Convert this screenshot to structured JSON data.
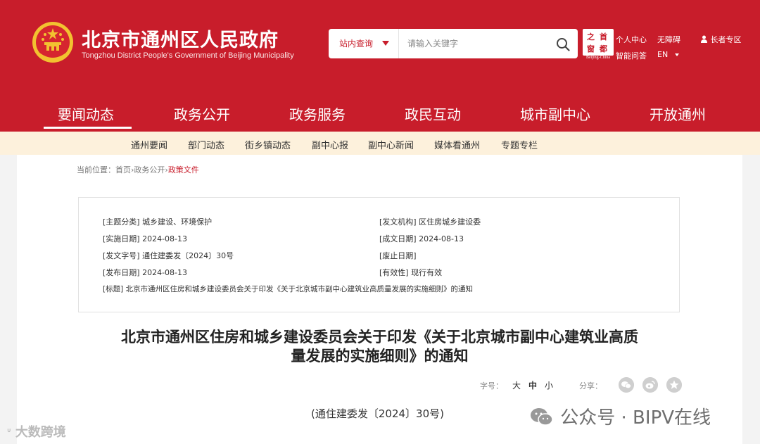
{
  "header": {
    "site_title": "北京市通州区人民政府",
    "site_subtitle": "Tongzhou District People's Government of Beijing Municipality",
    "search": {
      "scope": "站内查询",
      "placeholder": "请输入关键字"
    },
    "capital_logo": {
      "chars": [
        "首",
        "之",
        "都",
        "窗"
      ],
      "caption": "Beijing-China"
    },
    "links": {
      "personal_center": "个人中心",
      "smart_qa": "智能问答",
      "accessibility": "无障碍",
      "language": "EN",
      "elder_zone": "长者专区"
    }
  },
  "main_nav": [
    "要闻动态",
    "政务公开",
    "政务服务",
    "政民互动",
    "城市副中心",
    "开放通州"
  ],
  "sub_nav": [
    "通州要闻",
    "部门动态",
    "街乡镇动态",
    "副中心报",
    "副中心新闻",
    "媒体看通州",
    "专题专栏"
  ],
  "breadcrumb": {
    "prefix": "当前位置：",
    "home": "首页",
    "sep": "›",
    "section": "政务公开",
    "current": "政策文件"
  },
  "meta": {
    "topic": "[主题分类] 城乡建设、环境保护",
    "issuer": "[发文机构] 区住房城乡建设委",
    "effective_date": "[实施日期] 2024-08-13",
    "written_date": "[成文日期] 2024-08-13",
    "doc_no": "[发文字号] 通住建委发〔2024〕30号",
    "abolish_date": "[废止日期]",
    "publish_date": "[发布日期] 2024-08-13",
    "validity": "[有效性] 现行有效",
    "title": "[标题] 北京市通州区住房和城乡建设委员会关于印发《关于北京城市副中心建筑业高质量发展的实施细则》的通知"
  },
  "document": {
    "title_line1": "北京市通州区住房和城乡建设委员会关于印发《关于北京城市副中心建筑业高质",
    "title_line2": "量发展的实施细则》的通知",
    "font_size_label": "字号：",
    "font_sizes": [
      "大",
      "中",
      "小"
    ],
    "share_label": "分享：",
    "number": "(通住建委发〔2024〕30号)"
  },
  "watermarks": {
    "right": "公众号 · BIPV在线",
    "left": "大数跨境"
  },
  "colors": {
    "brand_red": "#c81d2b",
    "subnav_bg": "#fdf1dc",
    "gold": "#f2c230"
  }
}
